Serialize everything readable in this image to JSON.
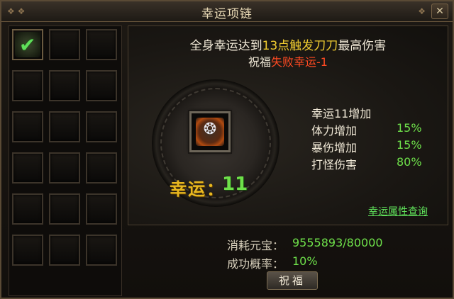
{
  "window": {
    "title": "幸运项链",
    "close_icon": "close-icon"
  },
  "slots": {
    "columns": 3,
    "rows": 6,
    "first_item_icon": "green-check-gem-icon"
  },
  "panel": {
    "line1_prefix": "全身幸运达到",
    "line1_highlight": "13点触发刀刀",
    "line1_suffix": "最高伤害",
    "line2_prefix": "祝福",
    "line2_red": "失败幸运-1",
    "luck_label": "幸运：",
    "luck_value": "11",
    "necklace_icon": "necklace-icon",
    "stats_header": "幸运11增加",
    "stats": [
      {
        "name": "体力增加",
        "value": "15%"
      },
      {
        "name": "暴伤增加",
        "value": "15%"
      },
      {
        "name": "打怪伤害",
        "value": "80%"
      }
    ],
    "query_link": "幸运属性查询"
  },
  "bottom": {
    "cost_label": "消耗元宝：",
    "cost_value": "9555893/80000",
    "rate_label": "成功概率：",
    "rate_value": "10%",
    "bless_button": "祝福"
  },
  "colors": {
    "highlight_yellow": "#f0cc30",
    "fail_red": "#ff4a22",
    "value_green": "#6ee04a"
  }
}
